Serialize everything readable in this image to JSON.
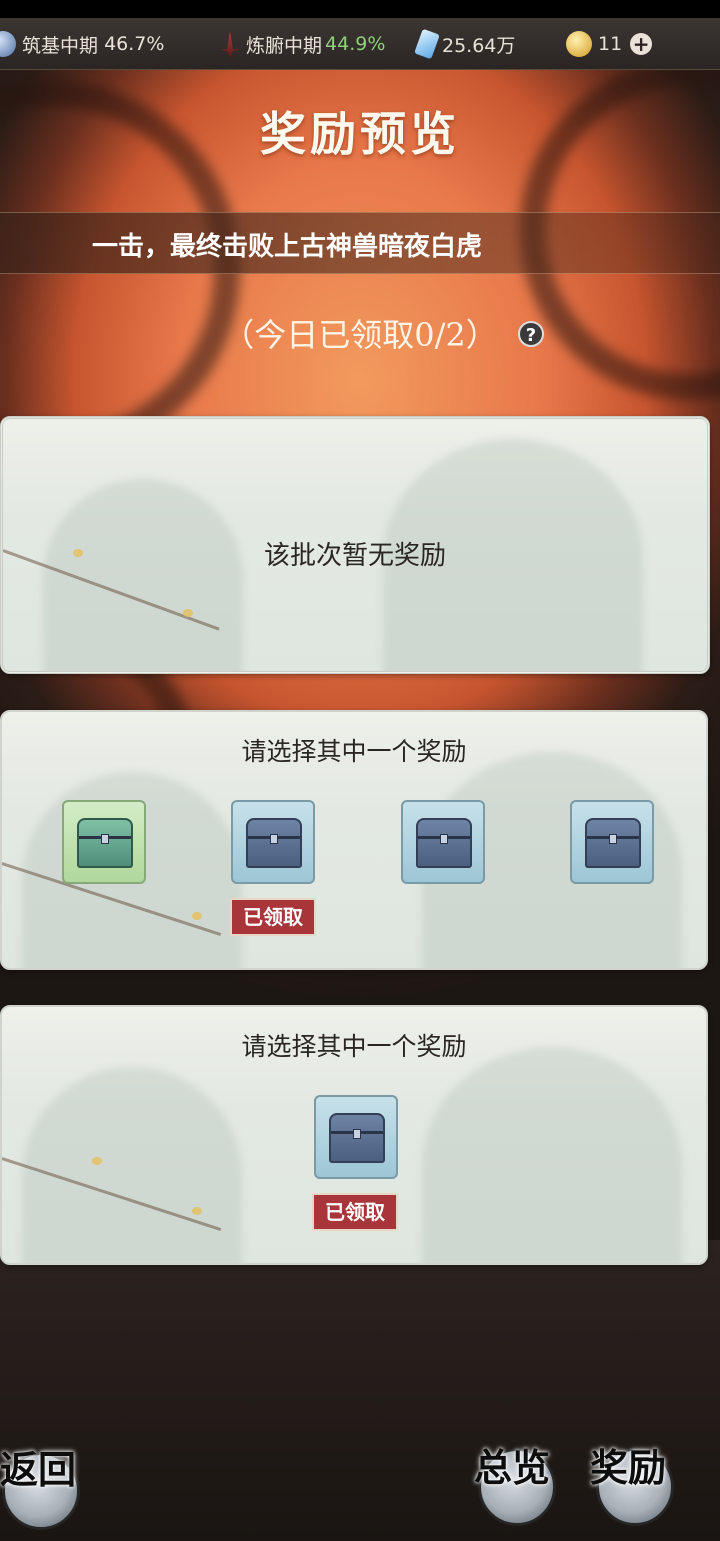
{
  "topbar": {
    "realm_1": {
      "name": "筑基中期",
      "progress": "46.7%",
      "icon": "yin-yang-icon"
    },
    "realm_2": {
      "name": "炼腑中期",
      "progress": "44.9%",
      "icon": "sword-icon"
    },
    "spirit_stones": {
      "value": "25.64万",
      "icon": "spirit-stone-icon"
    },
    "currency": {
      "value": "11",
      "icon": "gold-ingot-icon",
      "add_label": "+"
    }
  },
  "title": "奖励预览",
  "banner": "一击，最终击败上古神兽暗夜白虎",
  "claimed_line": "（今日已领取0/2）",
  "help_label": "?",
  "panel_1": {
    "text": "该批次暂无奖励"
  },
  "panel_2": {
    "prompt": "请选择其中一个奖励",
    "chests": [
      {
        "style": "green",
        "claimed": false
      },
      {
        "style": "blue",
        "claimed": true
      },
      {
        "style": "blue",
        "claimed": false
      },
      {
        "style": "blue",
        "claimed": false
      }
    ],
    "claimed_label": "已领取"
  },
  "panel_3": {
    "prompt": "请选择其中一个奖励",
    "chests": [
      {
        "style": "blue",
        "claimed": true
      }
    ],
    "claimed_label": "已领取"
  },
  "nav": {
    "back": "返回",
    "overview": "总览",
    "reward": "奖励"
  },
  "colors": {
    "accent_green": "#8fd07a",
    "claimed_red": "#a8353a",
    "panel_bg": "#e3e8e2"
  }
}
